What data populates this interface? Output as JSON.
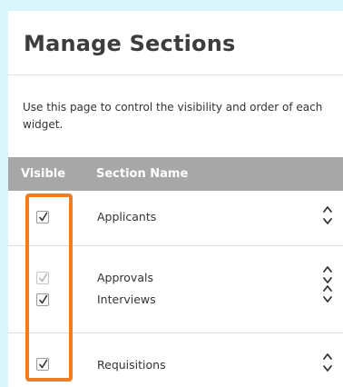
{
  "page": {
    "title": "Manage Sections",
    "description": "Use this page to control the visibility and order of each widget."
  },
  "table": {
    "headers": {
      "visible": "Visible",
      "section_name": "Section Name"
    },
    "rows": [
      {
        "label": "Applicants",
        "checked": true,
        "dimmed": false
      },
      {
        "label": "Approvals",
        "checked": true,
        "dimmed": true
      },
      {
        "label": "Interviews",
        "checked": true,
        "dimmed": false
      },
      {
        "label": "Requisitions",
        "checked": true,
        "dimmed": false
      }
    ]
  },
  "icons": {
    "checkbox_check": "check-icon",
    "reorder": "reorder-arrows-icon"
  },
  "colors": {
    "header_bg": "#a7a7a7",
    "highlight": "#f07c24",
    "page_bg": "#d9f6fc"
  }
}
